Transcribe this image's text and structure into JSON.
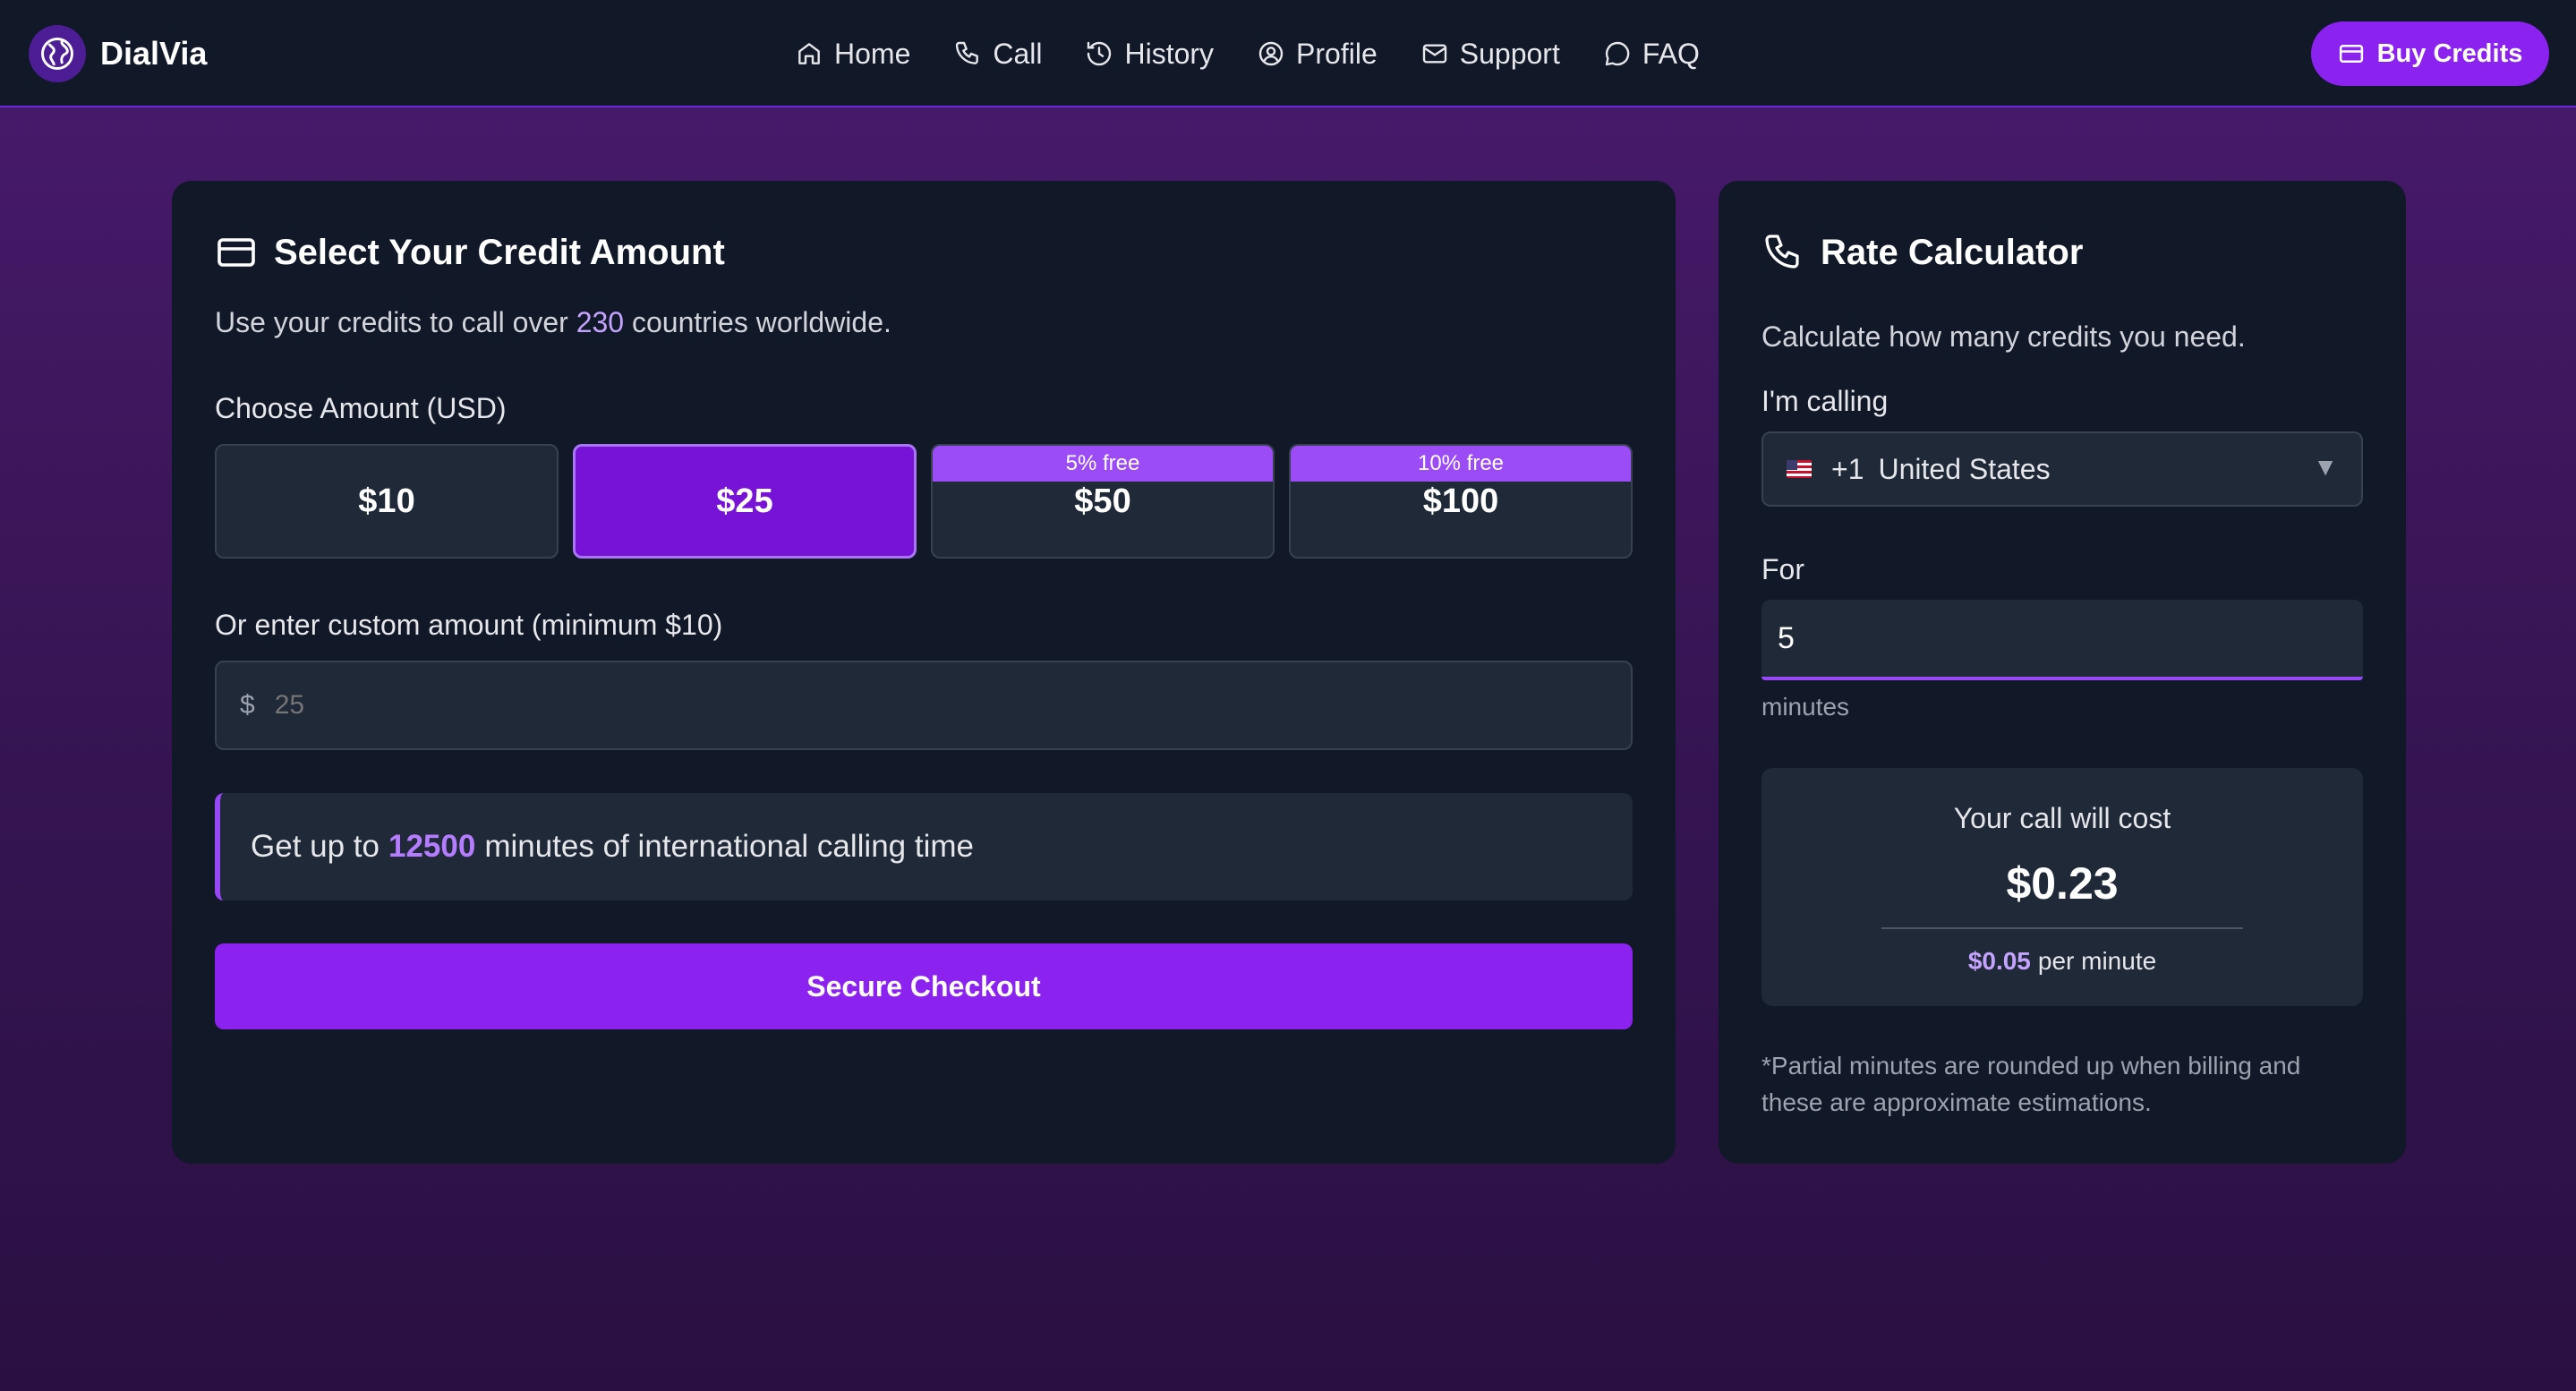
{
  "nav": {
    "brand": "DialVia",
    "links": [
      {
        "label": "Home",
        "icon": "home-icon"
      },
      {
        "label": "Call",
        "icon": "phone-icon"
      },
      {
        "label": "History",
        "icon": "history-icon"
      },
      {
        "label": "Profile",
        "icon": "user-circle-icon"
      },
      {
        "label": "Support",
        "icon": "mail-icon"
      },
      {
        "label": "FAQ",
        "icon": "chat-bubble-icon"
      }
    ],
    "cta_label": "Buy Credits"
  },
  "credit": {
    "title": "Select Your Credit Amount",
    "lead_prefix": "Use your credits to call over",
    "lead_count": "230",
    "lead_suffix": "countries worldwide.",
    "choose_label": "Choose Amount (USD)",
    "amounts": [
      {
        "label": "$10",
        "badge": "",
        "selected": false
      },
      {
        "label": "$25",
        "badge": "",
        "selected": true
      },
      {
        "label": "$50",
        "badge": "5% free",
        "selected": false
      },
      {
        "label": "$100",
        "badge": "10% free",
        "selected": false
      }
    ],
    "custom_label": "Or enter custom amount (minimum $10)",
    "currency_symbol": "$",
    "custom_placeholder": "25",
    "info_prefix": "Get up to",
    "info_minutes": "12500",
    "info_suffix": "minutes of international calling time",
    "checkout_label": "Secure Checkout"
  },
  "calculator": {
    "title": "Rate Calculator",
    "lead": "Calculate how many credits you need.",
    "calling_label": "I'm calling",
    "country_code": "+1",
    "country_name": "United States",
    "caret": "▼",
    "for_label": "For",
    "minutes_value": "5",
    "minutes_helper": "minutes",
    "cost_label": "Your call will cost",
    "cost_value": "$0.23",
    "rate_value": "$0.05",
    "rate_suffix": "per minute",
    "footnote": "*Partial minutes are rounded up when billing and these are approximate estimations."
  },
  "colors": {
    "accent": "#8b22f0",
    "selected": "#7613d6",
    "badge": "#9c4cf7",
    "highlight": "#c4a3ff",
    "card": "#111827",
    "surface": "#1f2937"
  }
}
